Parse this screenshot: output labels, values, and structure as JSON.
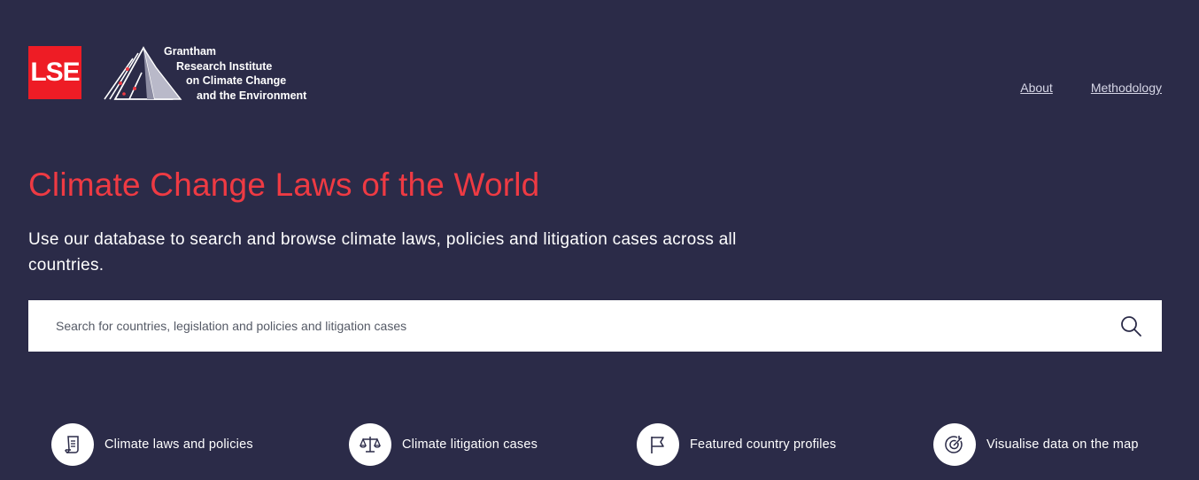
{
  "header": {
    "lse_logo_text": "LSE",
    "grantham_lines": [
      "Grantham",
      "Research Institute",
      "on Climate Change",
      "and the Environment"
    ],
    "nav": [
      {
        "label": "About"
      },
      {
        "label": "Methodology"
      }
    ]
  },
  "hero": {
    "title": "Climate Change Laws of the World",
    "intro": "Use our database to search and browse climate laws, policies and litigation cases across all countries."
  },
  "search": {
    "placeholder": "Search for countries, legislation and policies and litigation cases",
    "value": "",
    "icon": "search-icon"
  },
  "quick_links": [
    {
      "label": "Climate laws and policies",
      "icon": "document-icon"
    },
    {
      "label": "Climate litigation cases",
      "icon": "scales-icon"
    },
    {
      "label": "Featured country profiles",
      "icon": "flag-icon"
    },
    {
      "label": "Visualise data on the map",
      "icon": "target-icon"
    }
  ],
  "colors": {
    "background": "#2b2b48",
    "accent_red": "#ee3a43",
    "lse_red": "#ee1c25"
  }
}
